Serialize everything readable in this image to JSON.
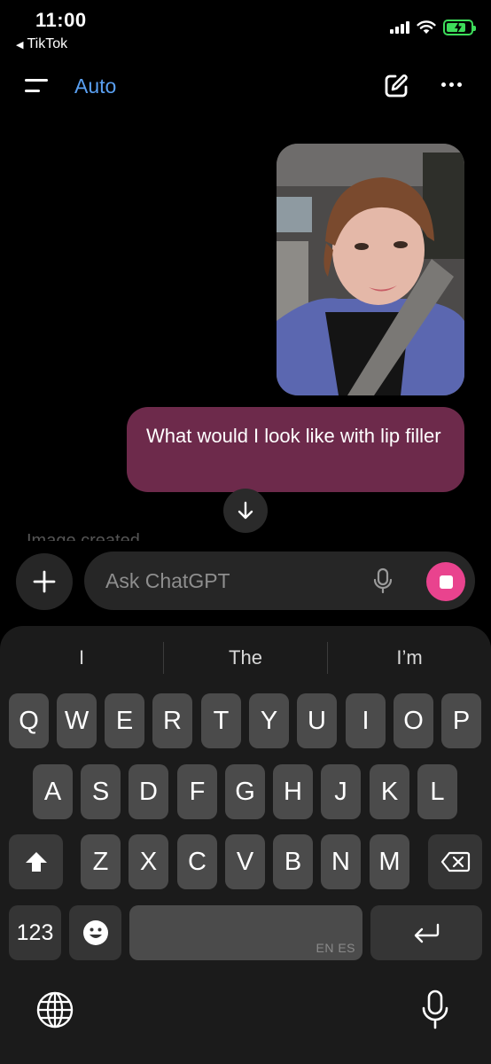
{
  "status_bar": {
    "time": "11:00",
    "back_app": "TikTok",
    "battery_color": "#3ddc5a"
  },
  "header": {
    "model_label": "Auto",
    "icons": [
      "menu-icon",
      "new-chat-icon",
      "more-icon"
    ],
    "accent_color": "#5aa0f2"
  },
  "chat": {
    "user_message": "What would I look like with lip filler",
    "bubble_color": "#6d2a4b",
    "faded_status": "Image created"
  },
  "composer": {
    "placeholder": "Ask ChatGPT",
    "stop_color": "#e9438e"
  },
  "keyboard": {
    "suggestions": [
      "I",
      "The",
      "I’m"
    ],
    "row1": [
      "Q",
      "W",
      "E",
      "R",
      "T",
      "Y",
      "U",
      "I",
      "O",
      "P"
    ],
    "row2": [
      "A",
      "S",
      "D",
      "F",
      "G",
      "H",
      "J",
      "K",
      "L"
    ],
    "row3": [
      "Z",
      "X",
      "C",
      "V",
      "B",
      "N",
      "M"
    ],
    "numbers_label": "123",
    "space_lang_label": "EN ES"
  }
}
